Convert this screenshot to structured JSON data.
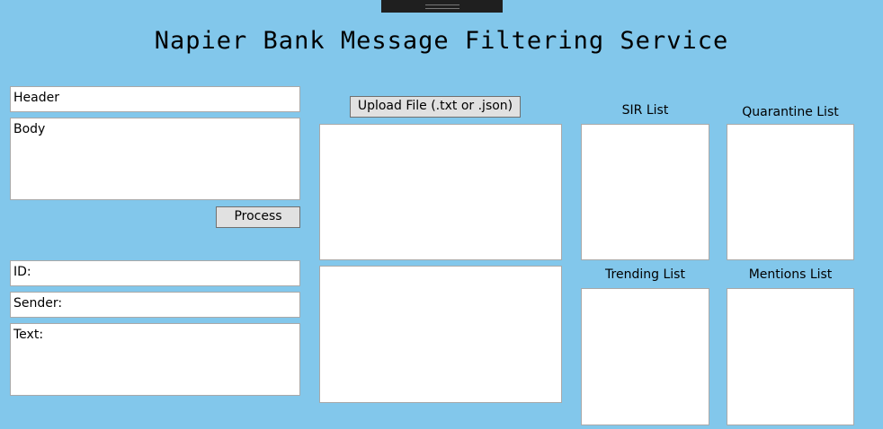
{
  "window": {
    "title": "Napier Bank Message Filtering Service"
  },
  "input": {
    "header_text": "Header",
    "body_text": "Body",
    "process_label": "Process"
  },
  "output": {
    "id_text": "ID:",
    "sender_text": "Sender:",
    "text_text": "Text:"
  },
  "upload": {
    "label": "Upload File (.txt or .json)"
  },
  "lists": {
    "sir": "SIR List",
    "quarantine": "Quarantine List",
    "trending": "Trending List",
    "mentions": "Mentions List"
  }
}
